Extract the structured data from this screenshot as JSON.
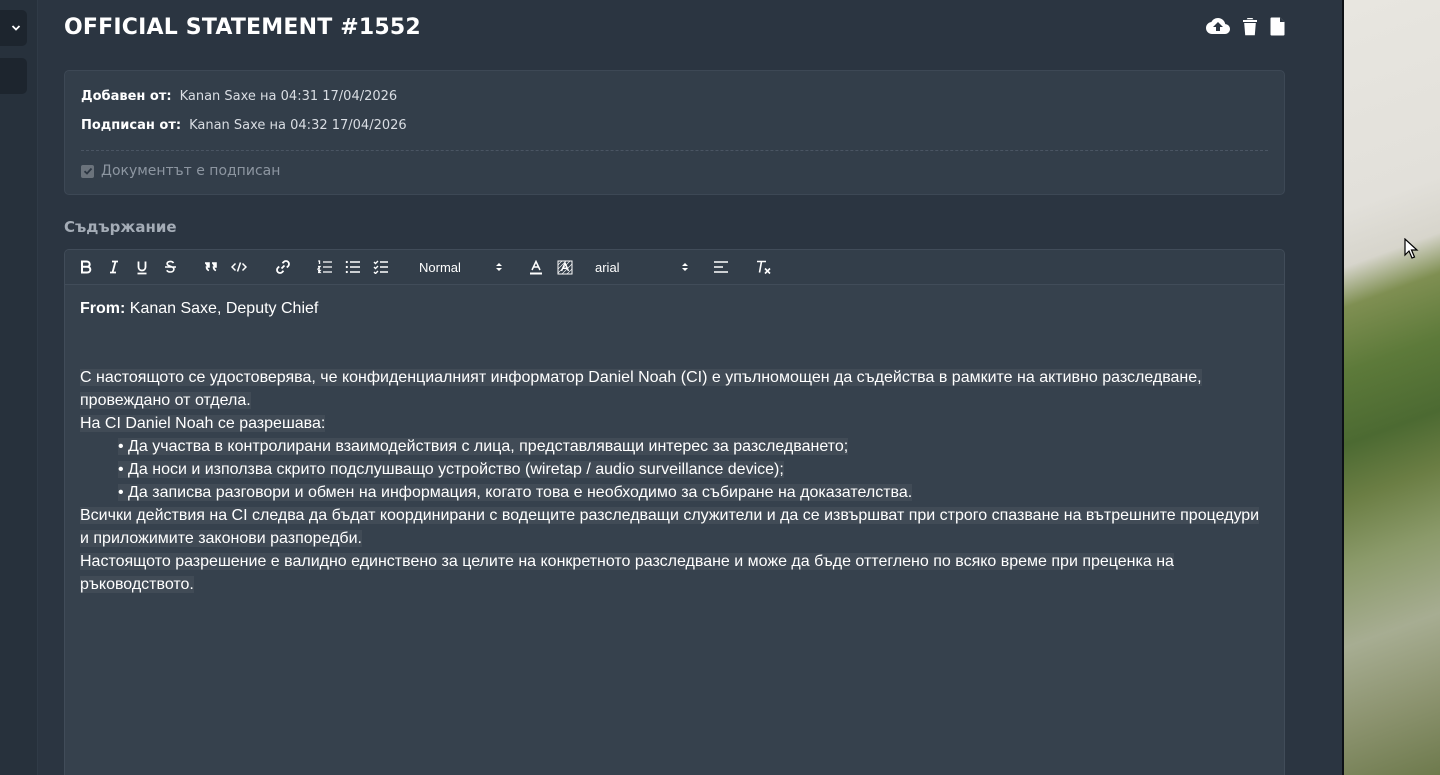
{
  "document": {
    "title": "OFFICIAL STATEMENT #1552",
    "actions": [
      {
        "name": "cloud-upload-icon"
      },
      {
        "name": "trash-icon"
      },
      {
        "name": "file-icon"
      }
    ]
  },
  "info": {
    "added_label": "Добавен от:",
    "added_value": "Kanan Saxe на 04:31 17/04/2026",
    "signed_label": "Подписан от:",
    "signed_value": "Kanan Saxe на 04:32 17/04/2026",
    "signed_checkbox_label": "Документът е подписан",
    "signed_checked": true
  },
  "content_label": "Съдържание",
  "toolbar": {
    "header_select": "Normal",
    "font_select": "arial",
    "buttons": [
      "bold-icon",
      "italic-icon",
      "underline-icon",
      "strike-icon",
      "blockquote-icon",
      "code-icon",
      "link-icon",
      "ordered-list-icon",
      "bullet-list-icon",
      "check-list-icon",
      "text-color-icon",
      "background-color-icon",
      "align-icon",
      "clear-format-icon"
    ]
  },
  "body": {
    "from_label": "From:",
    "from_value": " Kanan Saxe, Deputy Chief",
    "para1_line1": "С настоящото се удостоверява, че конфиденциалният информатор Daniel Noah (CI) е упълномощен да съдейства в рамките на активно разследване,",
    "para1_line2": "провеждано от отдела.",
    "para2": "На CI Daniel Noah се разрешава:",
    "bullet1": "• Да участва в контролирани взаимодействия с лица, представляващи интерес за разследването;",
    "bullet2": "• Да носи и използва скрито подслушващо устройство (wiretap / audio surveillance device);",
    "bullet3": "• Да записва разговори и обмен на информация, когато това е необходимо за събиране на доказателства.",
    "para3_line1": "Всички действия на CI следва да бъдат координирани с водещите разследващи служители и да се извършват при строго спазване на вътрешните процедури",
    "para3_line2": "и приложимите законови разпоредби.",
    "para4_line1": "Настоящото разрешение е валидно единствено за целите на конкретното разследване и може да бъде оттеглено по всяко време при преценка на",
    "para4_line2": "ръководството."
  }
}
